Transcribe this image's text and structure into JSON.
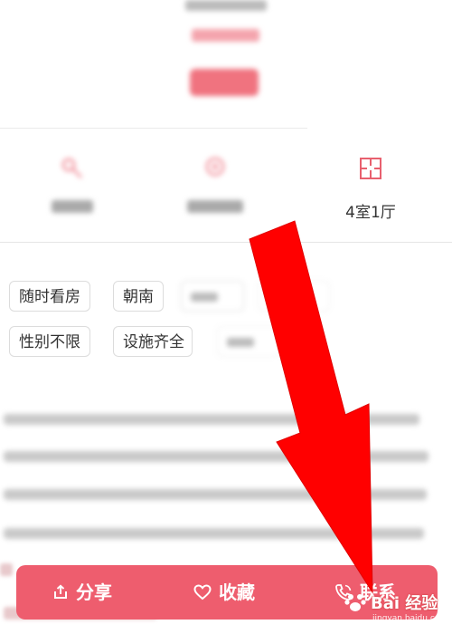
{
  "features": [
    {
      "icon": "key-icon",
      "label": ""
    },
    {
      "icon": "location-icon",
      "label": ""
    },
    {
      "icon": "floorplan-icon",
      "label": "4室1厅"
    }
  ],
  "tags": [
    "随时看房",
    "朝南",
    "性别不限",
    "设施齐全"
  ],
  "actionbar": {
    "share_label": "分享",
    "favorite_label": "收藏",
    "contact_label": "联系"
  },
  "watermark": {
    "brand": "Bai 经验",
    "url": "jingyan.baidu.com"
  },
  "colors": {
    "accent": "#ee5d6e",
    "arrow": "#ff0000"
  }
}
